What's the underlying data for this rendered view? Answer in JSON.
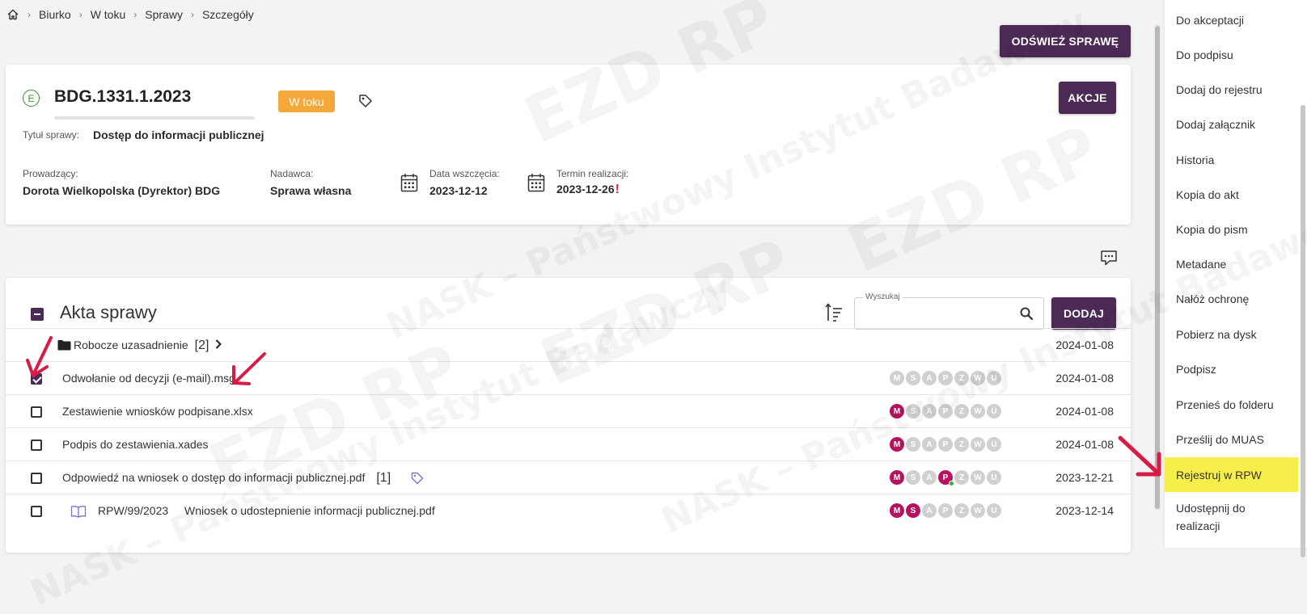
{
  "breadcrumb": {
    "items": [
      "Biurko",
      "W toku",
      "Sprawy",
      "Szczegóły"
    ]
  },
  "header": {
    "refresh_label": "ODŚWIEŻ SPRAWĘ"
  },
  "case": {
    "type_letter": "E",
    "number": "BDG.1331.1.2023",
    "status": "W toku",
    "actions_label": "AKCJE",
    "title_label": "Tytuł sprawy:",
    "title_value": "Dostęp do informacji publicznej",
    "leader_label": "Prowadzący:",
    "leader_value": "Dorota Wielkopolska (Dyrektor) BDG",
    "sender_label": "Nadawca:",
    "sender_value": "Sprawa własna",
    "start_label": "Data wszczęcia:",
    "start_value": "2023-12-12",
    "deadline_label": "Termin realizacji:",
    "deadline_value": "2023-12-26",
    "deadline_mark": "!"
  },
  "files": {
    "title": "Akta sprawy",
    "search_label": "Wyszukaj",
    "search_value": "",
    "add_label": "DODAJ",
    "flag_letters": [
      "M",
      "S",
      "A",
      "P",
      "Z",
      "W",
      "U"
    ],
    "rows": [
      {
        "name": "Robocze uzasadnienie",
        "count": "[2]",
        "date": "2024-01-08"
      },
      {
        "name": "Odwołanie od decyzji (e-mail).msg",
        "date": "2024-01-08"
      },
      {
        "name": "Zestawienie wniosków podpisane.xlsx",
        "date": "2024-01-08"
      },
      {
        "name": "Podpis do zestawienia.xades",
        "date": "2024-01-08"
      },
      {
        "name": "Odpowiedź na wniosek o dostęp do informacji publicznej.pdf",
        "count": "[1]",
        "date": "2023-12-21"
      },
      {
        "rpw": "RPW/99/2023",
        "name": "Wniosek o udostepnienie informacji publicznej.pdf",
        "date": "2023-12-14"
      }
    ]
  },
  "menu": {
    "items": [
      "Do akceptacji",
      "Do podpisu",
      "Dodaj do rejestru",
      "Dodaj załącznik",
      "Historia",
      "Kopia do akt",
      "Kopia do pism",
      "Metadane",
      "Nałóż ochronę",
      "Pobierz na dysk",
      "Podpisz",
      "Przenieś do folderu",
      "Prześlij do MUAS",
      "Rejestruj w RPW",
      "Udostępnij do realizacji"
    ]
  },
  "colors": {
    "primary": "#4b2a55",
    "status": "#f5a83a",
    "flag_on": "#b5135f",
    "flag_off": "#d0d0d0",
    "highlight": "#f6ef4b",
    "arrow": "#d81b45"
  },
  "watermark": {
    "text1": "NASK – Państwowy Instytut Badawczy",
    "text2": "EZD RP"
  }
}
